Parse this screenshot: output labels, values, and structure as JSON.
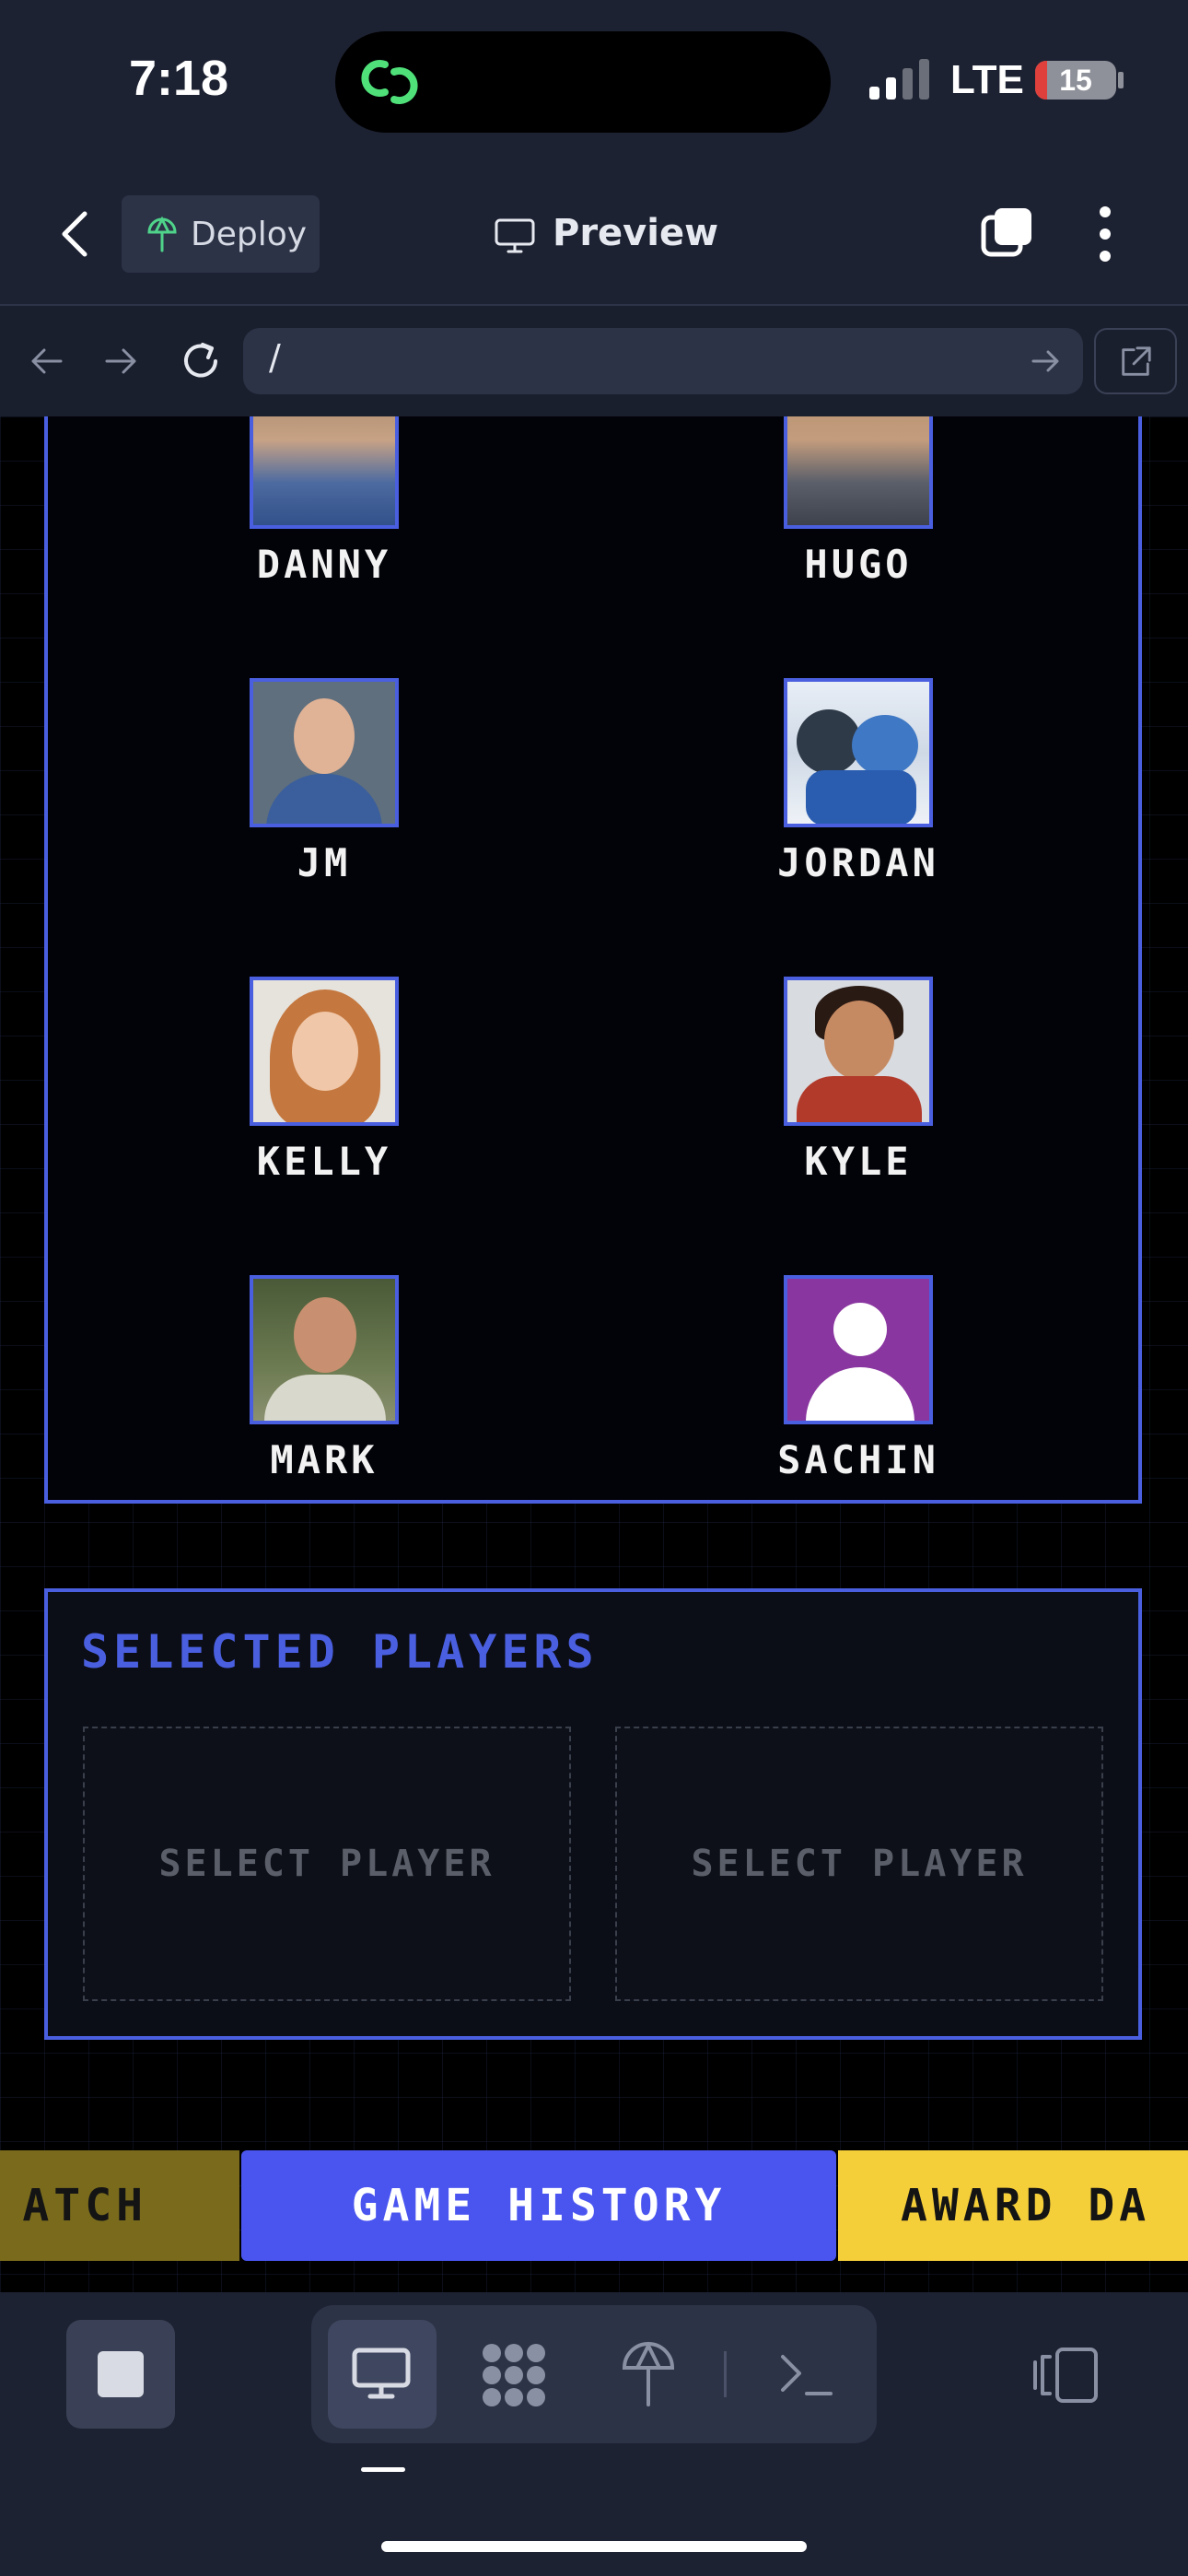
{
  "status_bar": {
    "time": "7:18",
    "network": "LTE",
    "battery": "15",
    "battery_level": 0.15,
    "signal_bars": 2
  },
  "app_bar": {
    "deploy_label": "Deploy",
    "preview_label": "Preview"
  },
  "url_bar": {
    "url": "/"
  },
  "players": [
    {
      "name": "DANNY",
      "avatar_color": "#6a7fa8"
    },
    {
      "name": "HUGO",
      "avatar_color": "#7a6e5e"
    },
    {
      "name": "JM",
      "avatar_color": "#5a6e8c"
    },
    {
      "name": "JORDAN",
      "avatar_color": "#4a6fa8"
    },
    {
      "name": "KELLY",
      "avatar_color": "#c98a58"
    },
    {
      "name": "KYLE",
      "avatar_color": "#8a4a3a"
    },
    {
      "name": "MARK",
      "avatar_color": "#7a806a"
    },
    {
      "name": "SACHIN",
      "avatar_color": "#8a36a0"
    }
  ],
  "selected": {
    "title": "SELECTED PLAYERS",
    "slots": [
      "SELECT PLAYER",
      "SELECT PLAYER"
    ]
  },
  "bottom_nav": {
    "match": "ATCH",
    "history": "GAME HISTORY",
    "award": "AWARD DA"
  },
  "colors": {
    "accent": "#4a5fe0",
    "history_button": "#4a55f0",
    "award_button": "#f5cf3a",
    "match_button": "#7a6b1c"
  },
  "icons": [
    "back-chevron-icon",
    "deploy-icon",
    "desktop-icon",
    "tabs-icon",
    "more-icon",
    "arrow-left-icon",
    "arrow-right-icon",
    "reload-icon",
    "open-external-icon",
    "stop-icon",
    "grid-icon",
    "antenna-icon",
    "terminal-icon",
    "devices-icon"
  ]
}
